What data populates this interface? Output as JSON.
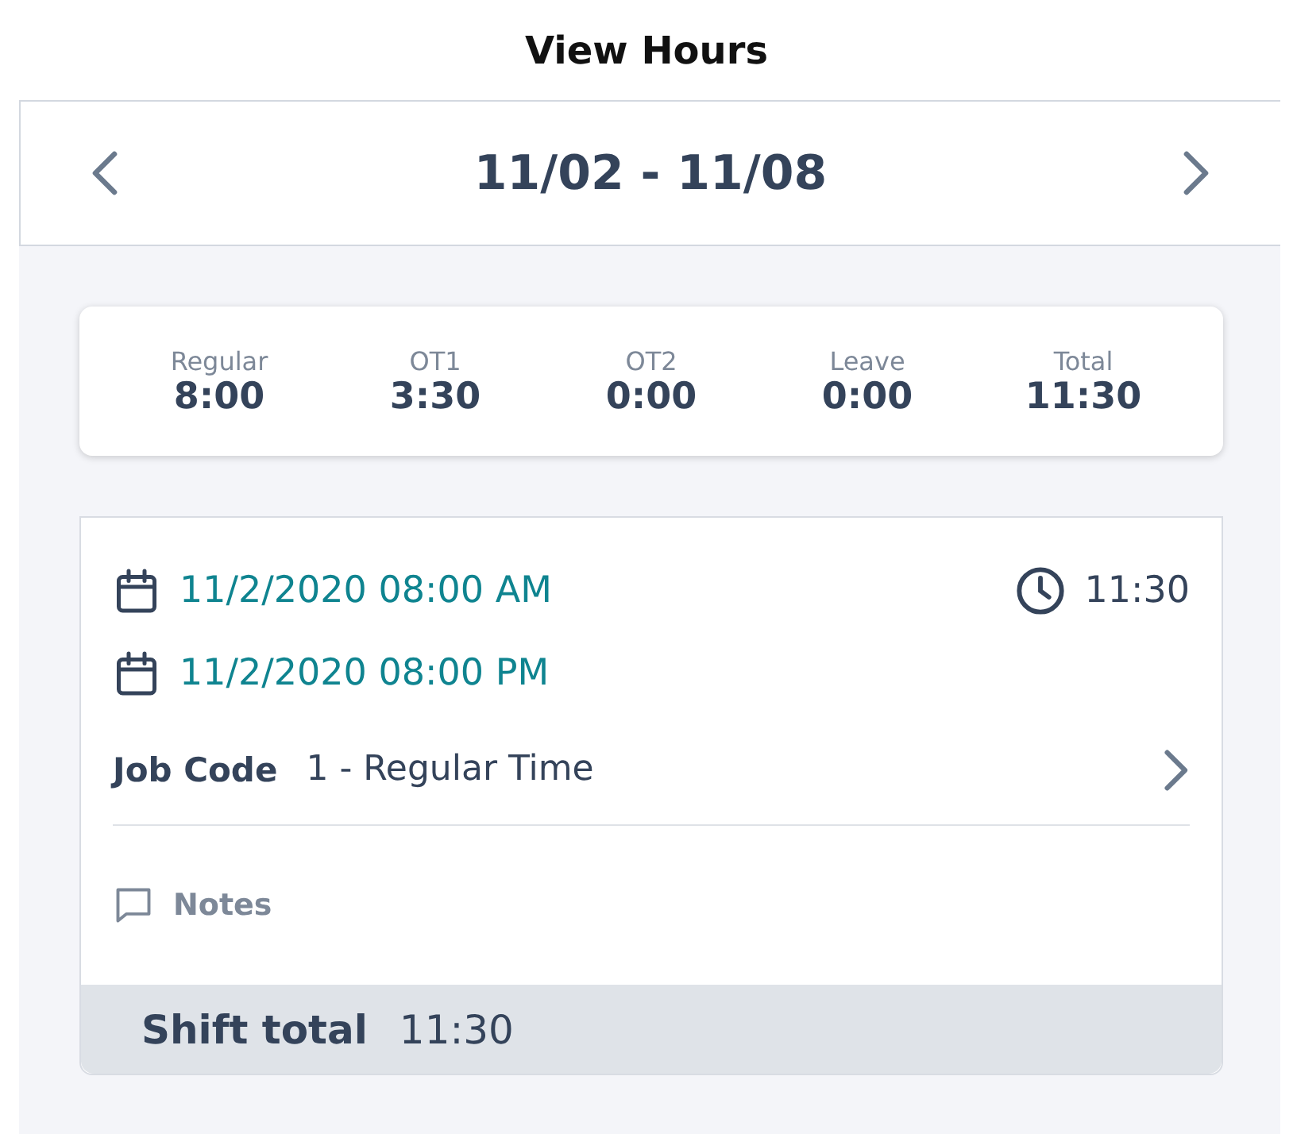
{
  "title": "View Hours",
  "week": {
    "range": "11/02 - 11/08"
  },
  "summary": [
    {
      "label": "Regular",
      "value": "8:00"
    },
    {
      "label": "OT1",
      "value": "3:30"
    },
    {
      "label": "OT2",
      "value": "0:00"
    },
    {
      "label": "Leave",
      "value": "0:00"
    },
    {
      "label": "Total",
      "value": "11:30"
    }
  ],
  "shift": {
    "start": "11/2/2020 08:00 AM",
    "end": "11/2/2020 08:00 PM",
    "duration": "11:30",
    "job_code_label": "Job Code",
    "job_code": "1 - Regular Time",
    "notes": "Notes",
    "total_label": "Shift total",
    "total": "11:30"
  }
}
